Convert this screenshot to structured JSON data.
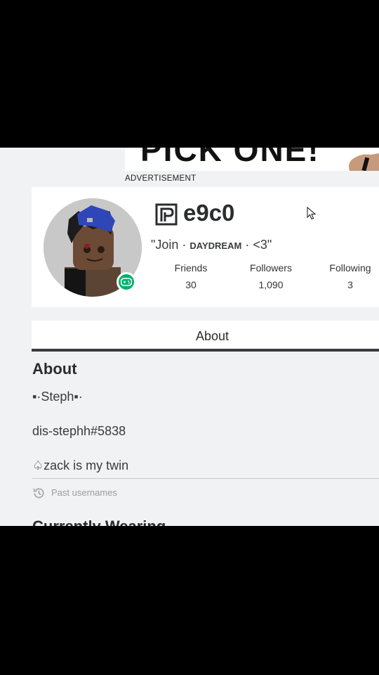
{
  "ad": {
    "banner_text": "PICK ONE!",
    "label": "ADVERTISEMENT"
  },
  "profile": {
    "username": "e9c0",
    "status": {
      "prefix": "\"Join · ",
      "highlight": "DAYDREAM",
      "suffix": " · <3\""
    },
    "stats": [
      {
        "label": "Friends",
        "value": "30"
      },
      {
        "label": "Followers",
        "value": "1,090"
      },
      {
        "label": "Following",
        "value": "3"
      }
    ],
    "presence": "in-game"
  },
  "tabs": [
    {
      "label": "About",
      "active": true
    }
  ],
  "about": {
    "heading": "About",
    "lines": [
      "▪·Steph▪·",
      "dis-stephh#5838",
      "♤zack is my twin"
    ],
    "past_usernames_label": "Past usernames"
  },
  "wearing": {
    "heading": "Currently Wearing"
  },
  "colors": {
    "presence_green": "#00b06f",
    "tab_underline": "#393b3d",
    "page_bg": "#f1f2f4"
  },
  "icons": [
    "verified-logo-icon",
    "controller-icon",
    "history-icon",
    "cursor-icon"
  ]
}
